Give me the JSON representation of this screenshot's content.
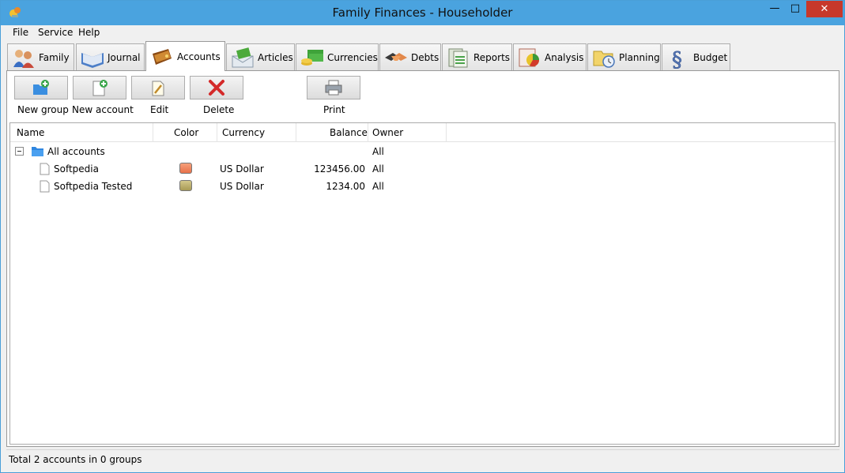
{
  "window": {
    "title": "Family Finances - Householder",
    "minimize_icon": "minimize-icon",
    "maximize_icon": "maximize-icon",
    "close_icon": "close-icon"
  },
  "menu": [
    "File",
    "Service",
    "Help"
  ],
  "tabs": [
    {
      "label": "Family",
      "icon": "family-icon"
    },
    {
      "label": "Journal",
      "icon": "journal-icon"
    },
    {
      "label": "Accounts",
      "icon": "wallet-icon",
      "active": true
    },
    {
      "label": "Articles",
      "icon": "articles-icon"
    },
    {
      "label": "Currencies",
      "icon": "currencies-icon"
    },
    {
      "label": "Debts",
      "icon": "debts-icon"
    },
    {
      "label": "Reports",
      "icon": "reports-icon"
    },
    {
      "label": "Analysis",
      "icon": "analysis-icon"
    },
    {
      "label": "Planning",
      "icon": "planning-icon"
    },
    {
      "label": "Budget",
      "icon": "budget-icon"
    }
  ],
  "toolbar": {
    "new_group": "New group",
    "new_account": "New account",
    "edit": "Edit",
    "delete": "Delete",
    "print": "Print"
  },
  "grid": {
    "columns": [
      "Name",
      "Color",
      "Currency",
      "Balance",
      "Owner"
    ],
    "group": {
      "name": "All accounts",
      "owner": "All"
    },
    "rows": [
      {
        "name": "Softpedia",
        "color": "#e8714a",
        "currency": "US Dollar",
        "balance": "123456.00",
        "owner": "All"
      },
      {
        "name": "Softpedia Tested",
        "color": "#a89a55",
        "currency": "US Dollar",
        "balance": "1234.00",
        "owner": "All"
      }
    ]
  },
  "status": {
    "text": "Total 2 accounts in 0 groups"
  },
  "colors": {
    "titlebar": "#4aa3df",
    "close": "#c7382b"
  }
}
